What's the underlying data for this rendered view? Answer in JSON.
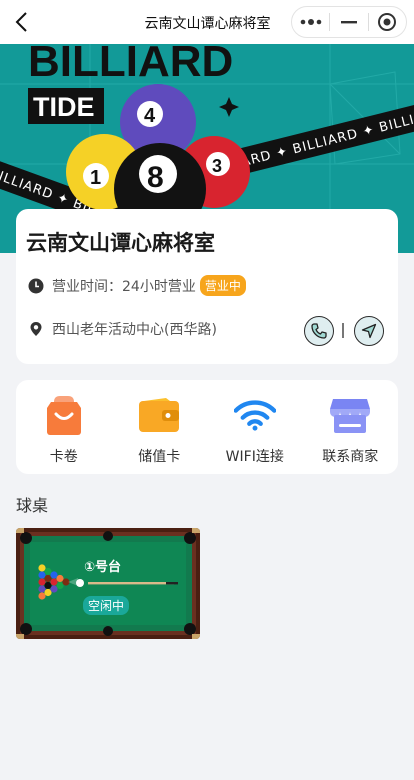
{
  "nav": {
    "title": "云南文山谭心麻将室"
  },
  "banner": {
    "word1": "BILLIARD",
    "word2": "TIDE",
    "ribbon_text": "BILLIARD ✦ BILLIARD ✦ BILLIARD ✦",
    "ball_numbers": [
      "4",
      "1",
      "8",
      "3"
    ]
  },
  "shop": {
    "name": "云南文山谭心麻将室",
    "hours_label": "营业时间：24小时营业",
    "status_badge": "营业中",
    "address": "西山老年活动中心(西华路)",
    "divider": "|"
  },
  "services": [
    {
      "label": "卡卷",
      "icon": "coupon-bag-icon"
    },
    {
      "label": "储值卡",
      "icon": "wallet-icon"
    },
    {
      "label": "WIFI连接",
      "icon": "wifi-icon"
    },
    {
      "label": "联系商家",
      "icon": "store-icon"
    }
  ],
  "tables_section": {
    "title": "球桌",
    "items": [
      {
        "name": "①号台",
        "status": "空闲中"
      }
    ]
  },
  "colors": {
    "accent_orange": "#f7a51c",
    "teal": "#1aa89a",
    "banner_bg": "#129a98",
    "felt_green": "#127a4e"
  }
}
